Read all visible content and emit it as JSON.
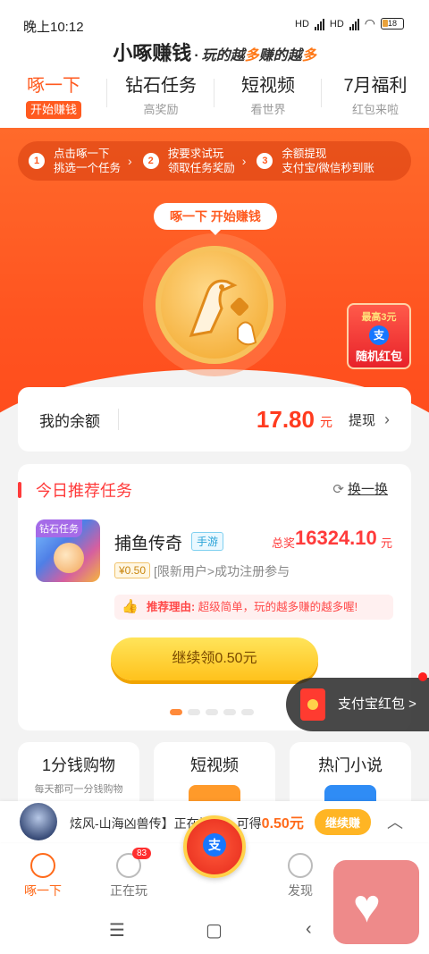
{
  "status_bar": {
    "time": "晚上10:12",
    "net1": "HD",
    "net2": "HD",
    "battery": "18"
  },
  "header": {
    "brand": "小啄赚钱",
    "dot": "·",
    "slogan_a": "玩的越",
    "slogan_b": "多",
    "slogan_c": "赚的越",
    "slogan_d": "多",
    "tabs": [
      {
        "title": "啄一下",
        "sub": "开始赚钱"
      },
      {
        "title": "钻石任务",
        "sub": "高奖励"
      },
      {
        "title": "短视频",
        "sub": "看世界"
      },
      {
        "title": "7月福利",
        "sub": "红包来啦"
      }
    ]
  },
  "steps": [
    {
      "num": "1",
      "line1": "点击啄一下",
      "line2": "挑选一个任务"
    },
    {
      "num": "2",
      "line1": "按要求试玩",
      "line2": "领取任务奖励"
    },
    {
      "num": "3",
      "line1": "余额提现",
      "line2": "支付宝/微信秒到账"
    }
  ],
  "hero": {
    "bubble": "啄一下 开始赚钱"
  },
  "redpack": {
    "top": "最高3元",
    "alipay": "支",
    "bottom": "随机红包"
  },
  "balance": {
    "label": "我的余额",
    "amount": "17.80",
    "unit": "元",
    "withdraw": "提现"
  },
  "task": {
    "title": "今日推荐任务",
    "swap": "换一换",
    "game": {
      "tag": "钻石任务",
      "name": "捕鱼传奇",
      "type": "手游",
      "prize_label": "总奖",
      "prize": "16324.10",
      "prize_unit": "元",
      "pay": "¥0.50",
      "desc": "[限新用户>成功注册参与",
      "reason_label": "推荐理由:",
      "reason": "超级简单，玩的越多赚的越多喔!",
      "cta": "继续领0.50元"
    }
  },
  "alipay_float": {
    "label": "支付宝红包 >"
  },
  "categories": [
    {
      "title": "1分钱购物",
      "sub": "每天都可一分钱购物"
    },
    {
      "title": "短视频",
      "sub": ""
    },
    {
      "title": "热门小说",
      "sub": ""
    }
  ],
  "notice": {
    "text_a": "炫风-山海凶兽传】正在试玩，可得",
    "amount": "0.50元",
    "button": "继续赚",
    "up": "︿"
  },
  "nav": {
    "items": [
      {
        "label": "啄一下"
      },
      {
        "label": "正在玩",
        "badge": "83"
      },
      {
        "label": ""
      },
      {
        "label": "发现"
      },
      {
        "label": ""
      }
    ],
    "center_icon": "支"
  },
  "colors": {
    "accent": "#ff5a1f",
    "price": "#ff3b1f",
    "cta": "#ffc21c"
  }
}
